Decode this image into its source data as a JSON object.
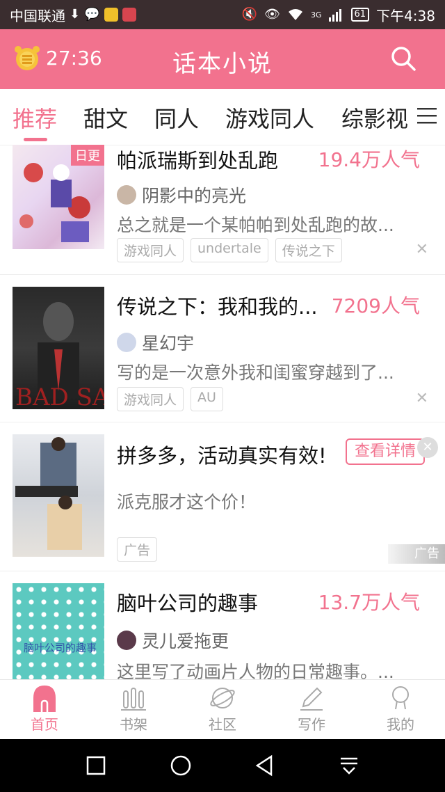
{
  "status_bar": {
    "carrier": "中国联通",
    "network": "3G",
    "battery": "61",
    "time": "下午4:38"
  },
  "app_bar": {
    "timer": "27:36",
    "title": "话本小说"
  },
  "tabs": [
    {
      "label": "推荐",
      "active": true
    },
    {
      "label": "甜文"
    },
    {
      "label": "同人"
    },
    {
      "label": "游戏同人"
    },
    {
      "label": "综影视"
    }
  ],
  "feed": [
    {
      "badge": "日更",
      "title": "帕派瑞斯到处乱跑",
      "popularity": "19.4万人气",
      "author": "阴影中的亮光",
      "description": "总之就是一个某帕帕到处乱跑的故...",
      "tags": [
        "游戏同人",
        "undertale",
        "传说之下"
      ]
    },
    {
      "title": "传说之下：我和我的...",
      "popularity": "7209人气",
      "author": "星幻宇",
      "description": "写的是一次意外我和闺蜜穿越到了...",
      "tags": [
        "游戏同人",
        "AU"
      ]
    },
    {
      "ad": true,
      "title": "拼多多，活动真实有效!",
      "action": "查看详情",
      "description": "派克服才这个价！",
      "tag": "广告",
      "mark": "广告"
    },
    {
      "title": "脑叶公司的趣事",
      "popularity": "13.7万人气",
      "author": "灵儿爱拖更",
      "description": "这里写了动画片人物的日常趣事。..."
    }
  ],
  "bottom_nav": [
    {
      "label": "首页",
      "icon": "home-icon",
      "active": true
    },
    {
      "label": "书架",
      "icon": "bookshelf-icon"
    },
    {
      "label": "社区",
      "icon": "planet-icon"
    },
    {
      "label": "写作",
      "icon": "pen-icon"
    },
    {
      "label": "我的",
      "icon": "profile-icon"
    }
  ],
  "colors": {
    "accent": "#f2728e",
    "status_bar": "#3a2d2f"
  }
}
